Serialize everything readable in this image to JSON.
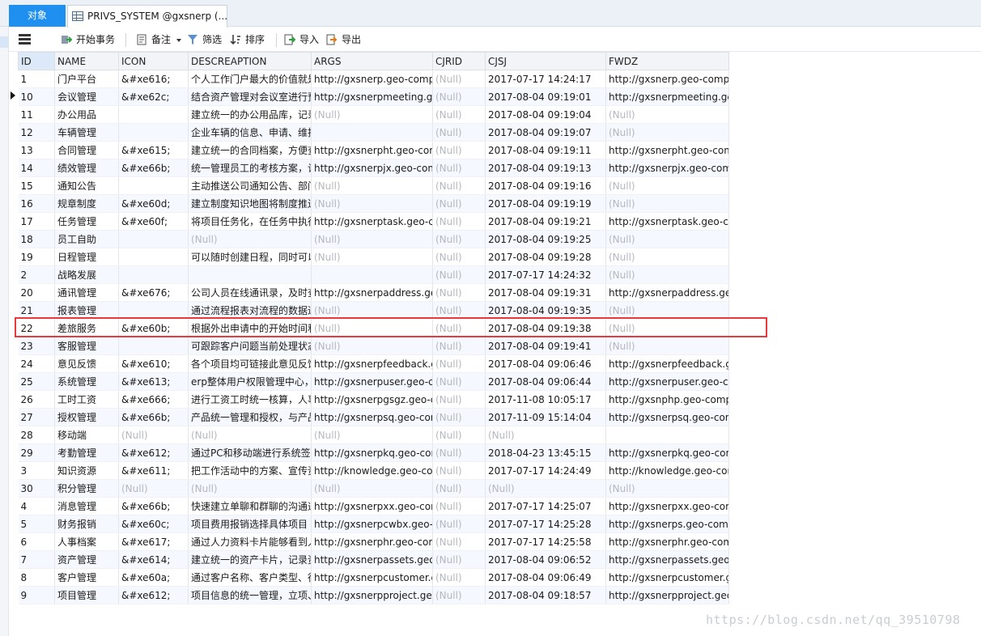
{
  "tabs": {
    "objects_label": "对象",
    "table_tab_label": "PRIVS_SYSTEM @gxsnerp (..."
  },
  "toolbar": {
    "begin_transaction": "开始事务",
    "memo": "备注",
    "filter": "筛选",
    "sort": "排序",
    "import": "导入",
    "export": "导出"
  },
  "grid": {
    "columns": [
      "ID",
      "NAME",
      "ICON",
      "DESCREAPTION",
      "ARGS",
      "CJRID",
      "CJSJ",
      "FWDZ"
    ],
    "rows": [
      [
        "1",
        "门户平台",
        "&#xe616;",
        "个人工作门户最大的价值就是",
        "http://gxsnerp.geo-comp",
        "(Null)",
        "2017-07-17 14:24:17",
        "http://gxsnerp.geo-comp"
      ],
      [
        "10",
        "会议管理",
        "&#xe62c;",
        "结合资产管理对会议室进行预",
        "http://gxsnerpmeeting.ge",
        "(Null)",
        "2017-08-04 09:19:01",
        "http://gxsnerpmeeting.ge"
      ],
      [
        "11",
        "办公用品",
        "",
        "建立统一的办公用品库，记录",
        "(Null)",
        "(Null)",
        "2017-08-04 09:19:04",
        "(Null)"
      ],
      [
        "12",
        "车辆管理",
        "",
        "企业车辆的信息、申请、维护",
        "",
        "(Null)",
        "2017-08-04 09:19:07",
        "(Null)"
      ],
      [
        "13",
        "合同管理",
        "&#xe615;",
        "建立统一的合同档案，方便查",
        "http://gxsnerpht.geo-com",
        "(Null)",
        "2017-08-04 09:19:11",
        "http://gxsnerpht.geo-com"
      ],
      [
        "14",
        "绩效管理",
        "&#xe66b;",
        "统一管理员工的考核方案，让",
        "http://gxsnerpjx.geo-com",
        "(Null)",
        "2017-08-04 09:19:13",
        "http://gxsnerpjx.geo-com"
      ],
      [
        "15",
        "通知公告",
        "",
        "主动推送公司通知公告、部门",
        "(Null)",
        "(Null)",
        "2017-08-04 09:19:16",
        "(Null)"
      ],
      [
        "16",
        "规章制度",
        "&#xe60d;",
        "建立制度知识地图将制度推送",
        "(Null)",
        "(Null)",
        "2017-08-04 09:19:19",
        "(Null)"
      ],
      [
        "17",
        "任务管理",
        "&#xe60f;",
        "将项目任务化，在任务中执行",
        "http://gxsnerptask.geo-co",
        "(Null)",
        "2017-08-04 09:19:21",
        "http://gxsnerptask.geo-co"
      ],
      [
        "18",
        "员工自助",
        "",
        "(Null)",
        "(Null)",
        "(Null)",
        "2017-08-04 09:19:25",
        "(Null)"
      ],
      [
        "19",
        "日程管理",
        "",
        "可以随时创建日程，同时可以",
        "(Null)",
        "(Null)",
        "2017-08-04 09:19:28",
        "(Null)"
      ],
      [
        "2",
        "战略发展",
        "",
        "",
        "",
        "(Null)",
        "2017-07-17 14:24:32",
        "(Null)"
      ],
      [
        "20",
        "通讯管理",
        "&#xe676;",
        "公司人员在线通讯录，及时查",
        "http://gxsnerpaddress.ge",
        "(Null)",
        "2017-08-04 09:19:31",
        "http://gxsnerpaddress.ge"
      ],
      [
        "21",
        "报表管理",
        "",
        "通过流程报表对流程的数据进",
        "(Null)",
        "(Null)",
        "2017-08-04 09:19:35",
        "(Null)"
      ],
      [
        "22",
        "差旅服务",
        "&#xe60b;",
        "根据外出申请中的开始时间和",
        "(Null)",
        "(Null)",
        "2017-08-04 09:19:38",
        "(Null)"
      ],
      [
        "23",
        "客服管理",
        "",
        "可跟踪客户问题当前处理状态",
        "(Null)",
        "(Null)",
        "2017-08-04 09:19:41",
        "(Null)"
      ],
      [
        "24",
        "意见反馈",
        "&#xe610;",
        "各个项目均可链接此意见反馈",
        "http://gxsnerpfeedback.g",
        "(Null)",
        "2017-08-04 09:06:46",
        "http://gxsnerpfeedback.g"
      ],
      [
        "25",
        "系统管理",
        "&#xe613;",
        "erp整体用户权限管理中心，",
        "http://gxsnerpuser.geo-co",
        "(Null)",
        "2017-08-04 09:06:44",
        "http://gxsnerpuser.geo-co"
      ],
      [
        "26",
        "工时工资",
        "&#xe666;",
        "进行工资工时统一核算，人事",
        "http://gxsnerpgsgz.geo-c",
        "(Null)",
        "2017-11-08 10:05:17",
        "http://gxsnphp.geo-comp"
      ],
      [
        "27",
        "授权管理",
        "&#xe66b;",
        "产品统一管理和授权，与产品",
        "http://gxsnerpsq.geo-con",
        "(Null)",
        "2017-11-09 15:14:04",
        "http://gxsnerpsq.geo-con"
      ],
      [
        "28",
        "移动端",
        "(Null)",
        "(Null)",
        "(Null)",
        "(Null)",
        "(Null)",
        ""
      ],
      [
        "29",
        "考勤管理",
        "&#xe612;",
        "通过PC和移动端进行系统签到",
        "http://gxsnerpkq.geo-cor",
        "(Null)",
        "2018-04-23 13:45:15",
        "http://gxsnerpkq.geo-cor"
      ],
      [
        "3",
        "知识资源",
        "&#xe611;",
        "把工作活动中的方案、宣传资",
        "http://knowledge.geo-cor",
        "(Null)",
        "2017-07-17 14:24:49",
        "http://knowledge.geo-cor"
      ],
      [
        "30",
        "积分管理",
        "(Null)",
        "(Null)",
        "(Null)",
        "(Null)",
        "(Null)",
        "(Null)"
      ],
      [
        "4",
        "消息管理",
        "&#xe66b;",
        "快速建立单聊和群聊的沟通通",
        "http://gxsnerpxx.geo-com",
        "(Null)",
        "2017-07-17 14:25:07",
        "http://gxsnerpxx.geo-com"
      ],
      [
        "5",
        "财务报销",
        "&#xe60c;",
        "项目费用报销选择具体项目",
        "http://gxsnerpcwbx.geo-c",
        "(Null)",
        "2017-07-17 14:25:28",
        "http://gxsnerps.geo-comp"
      ],
      [
        "6",
        "人事档案",
        "&#xe617;",
        "通过人力资料卡片能够看到人",
        "http://gxsnerphr.geo-com",
        "(Null)",
        "2017-07-17 14:25:58",
        "http://gxsnerphr.geo-com"
      ],
      [
        "7",
        "资产管理",
        "&#xe614;",
        "建立统一的资产卡片，记录资",
        "http://gxsnerpassets.geo-",
        "(Null)",
        "2017-08-04 09:06:52",
        "http://gxsnerpassets.geo-"
      ],
      [
        "8",
        "客户管理",
        "&#xe60a;",
        "通过客户名称、客户类型、行",
        "http://gxsnerpcustomer.g",
        "(Null)",
        "2017-08-04 09:06:49",
        "http://gxsnerpcustomer.g"
      ],
      [
        "9",
        "项目管理",
        "&#xe612;",
        "项目信息的统一管理，立项、",
        "http://gxsnerpproject.gec",
        "(Null)",
        "2017-08-04 09:18:57",
        "http://gxsnerpproject.gec"
      ]
    ]
  },
  "watermark": "https://blog.csdn.net/qq_39510798",
  "colors": {
    "accent_tab": "#1f8ff0",
    "highlight_box": "#e8393c",
    "null_text": "#b4b8bd",
    "alt_row": "#f5f9ff"
  }
}
